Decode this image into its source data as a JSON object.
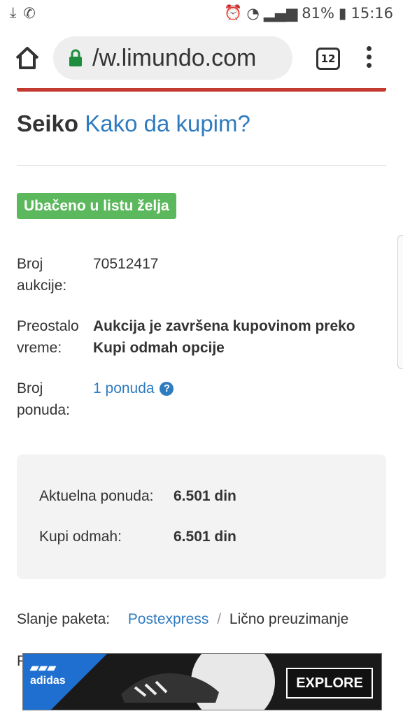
{
  "status_bar": {
    "battery": "81%",
    "time": "15:16"
  },
  "browser": {
    "url": "/w.limundo.com",
    "tab_count": "12"
  },
  "page": {
    "title_brand": "Seiko",
    "title_link": "Kako da kupim?",
    "wishlist_badge": "Ubačeno u listu želja",
    "details": [
      {
        "label": "Broj aukcije:",
        "value": "70512417"
      },
      {
        "label": "Preostalo vreme:",
        "value": "Aukcija je završena kupovinom preko Kupi odmah opcije"
      },
      {
        "label": "Broj ponuda:",
        "value": "1 ponuda"
      }
    ],
    "prices": [
      {
        "label": "Aktuelna ponuda:",
        "value": "6.501 din"
      },
      {
        "label": "Kupi odmah:",
        "value": "6.501 din"
      }
    ],
    "shipping": {
      "label": "Slanje paketa:",
      "option1": "Postexpress",
      "separator": "/",
      "option2": "Lično preuzimanje"
    },
    "truncated_char": "P"
  },
  "ad": {
    "brand": "adidas",
    "button": "EXPLORE"
  },
  "colors": {
    "link": "#2f7bbf",
    "badge": "#5cb85c",
    "accent_red": "#c23a2f"
  }
}
